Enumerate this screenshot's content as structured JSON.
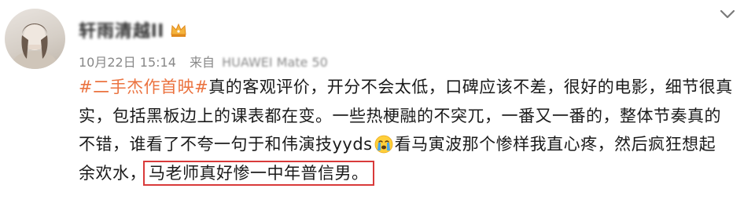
{
  "post": {
    "username": "轩雨清越ll",
    "date_time": "10月22日 15:14",
    "from_label": "来自",
    "device": "HUAWEI Mate 50",
    "hashtag": "#二手杰作首映#",
    "text_line1": "真的客观评价，开分不会太低，口碑应该不差，很好的电影，细节很真",
    "text_line2": "实，包括黑板边上的课表都在变。一些热梗融的不突兀，一番又一番的，整体节奏真的",
    "text_line3_a": "不错，谁看了不夸一句于和伟演技yyds",
    "text_line3_b": "看马寅波那个惨样我直心疼，然后疯狂想起",
    "text_line4_a": "余欢水，",
    "text_line4_highlight": "马老师真好惨一中年普信男。"
  },
  "icons": {
    "crown": "crown-badge-icon",
    "chevron": "chevron-down-icon",
    "emoji": "crying-emoji-icon"
  },
  "colors": {
    "hashtag": "#eb7340",
    "highlight_border": "#d93a3a",
    "meta": "#888888"
  }
}
